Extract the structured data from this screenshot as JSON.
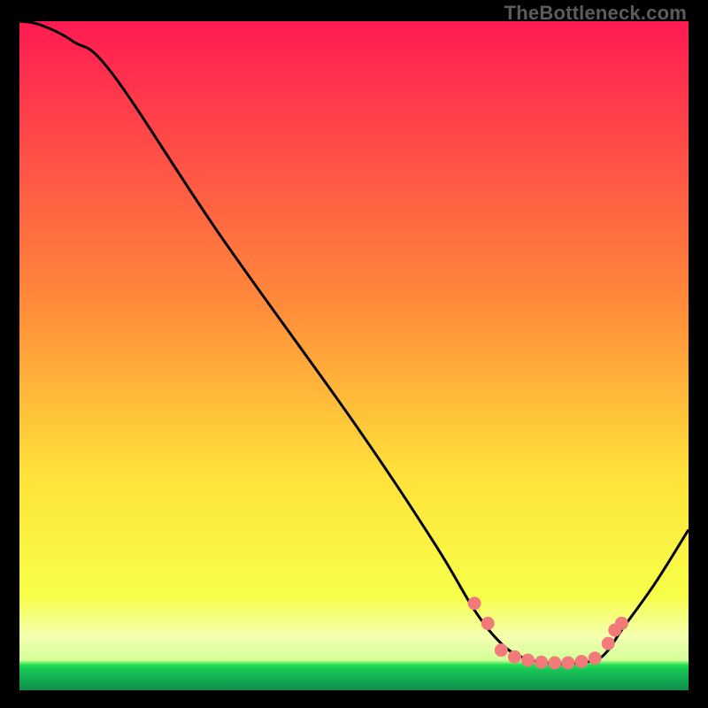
{
  "watermark": "TheBottleneck.com",
  "colors": {
    "top": "#ff1a52",
    "mid_upper": "#ff8a3a",
    "mid": "#ffe23a",
    "mid_lower": "#f7ff4a",
    "band_pale": "#f3ffb0",
    "green": "#1fe04f",
    "curve": "#000000",
    "marker_fill": "#f37a7a",
    "marker_stroke": "#d24e4e"
  },
  "chart_data": {
    "type": "line",
    "title": "",
    "xlabel": "",
    "ylabel": "",
    "xlim": [
      0,
      100
    ],
    "ylim": [
      0,
      100
    ],
    "curve": [
      {
        "x": 0,
        "y": 100
      },
      {
        "x": 3,
        "y": 99.5
      },
      {
        "x": 8,
        "y": 97
      },
      {
        "x": 14,
        "y": 92
      },
      {
        "x": 30,
        "y": 68
      },
      {
        "x": 50,
        "y": 40
      },
      {
        "x": 62,
        "y": 22
      },
      {
        "x": 68,
        "y": 12
      },
      {
        "x": 72,
        "y": 7
      },
      {
        "x": 75,
        "y": 5
      },
      {
        "x": 78,
        "y": 4.2
      },
      {
        "x": 82,
        "y": 4
      },
      {
        "x": 86,
        "y": 4.5
      },
      {
        "x": 88,
        "y": 6
      },
      {
        "x": 90,
        "y": 9
      },
      {
        "x": 95,
        "y": 16
      },
      {
        "x": 100,
        "y": 24
      }
    ],
    "markers": [
      {
        "x": 68,
        "y": 13
      },
      {
        "x": 70,
        "y": 10
      },
      {
        "x": 72,
        "y": 6
      },
      {
        "x": 74,
        "y": 5
      },
      {
        "x": 76,
        "y": 4.5
      },
      {
        "x": 78,
        "y": 4.2
      },
      {
        "x": 80,
        "y": 4.1
      },
      {
        "x": 82,
        "y": 4.1
      },
      {
        "x": 84,
        "y": 4.3
      },
      {
        "x": 86,
        "y": 4.8
      },
      {
        "x": 88,
        "y": 7
      },
      {
        "x": 89,
        "y": 9
      },
      {
        "x": 90,
        "y": 10
      }
    ]
  }
}
